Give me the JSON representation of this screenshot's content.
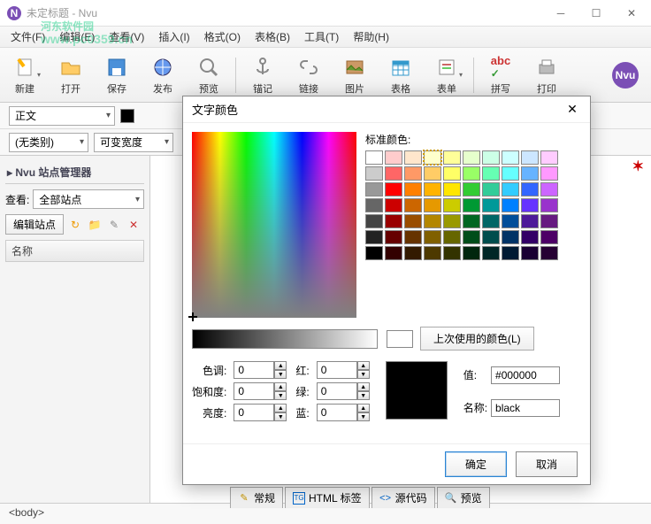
{
  "window": {
    "title": "未定标题 - Nvu",
    "app_icon_text": "N"
  },
  "watermark": {
    "line1": "河东软件园",
    "line2": "www.pc0359.cn"
  },
  "menu": {
    "file": "文件(F)",
    "edit": "编辑(E)",
    "view": "查看(V)",
    "insert": "插入(I)",
    "format": "格式(O)",
    "table": "表格(B)",
    "tools": "工具(T)",
    "help": "帮助(H)"
  },
  "toolbar": {
    "new": "新建",
    "open": "打开",
    "save": "保存",
    "publish": "发布",
    "preview": "预览",
    "anchor": "锚记",
    "link": "链接",
    "image": "图片",
    "table": "表格",
    "form": "表单",
    "spell": "拼写",
    "print": "打印",
    "nvu": "Nvu"
  },
  "formatbar": {
    "paragraph": "正文",
    "category": "(无类别)",
    "width": "可变宽度"
  },
  "sidebar": {
    "title_prefix": "Nvu",
    "title": "站点管理器",
    "view_label": "查看:",
    "view_value": "全部站点",
    "edit_btn": "编辑站点",
    "column": "名称"
  },
  "tabs": {
    "normal": "常规",
    "html": "HTML 标签",
    "source": "源代码",
    "preview": "预览"
  },
  "status": {
    "path": "<body>"
  },
  "dialog": {
    "title": "文字颜色",
    "standard_label": "标准颜色:",
    "last_used": "上次使用的颜色(L)",
    "hue": "色调:",
    "sat": "饱和度:",
    "light": "亮度:",
    "red": "红:",
    "green": "绿:",
    "blue": "蓝:",
    "value_label": "值:",
    "name_label": "名称:",
    "hue_v": "0",
    "sat_v": "0",
    "light_v": "0",
    "red_v": "0",
    "green_v": "0",
    "blue_v": "0",
    "hex": "#000000",
    "name": "black",
    "ok": "确定",
    "cancel": "取消",
    "swatches": [
      "#ffffff",
      "#ffcccc",
      "#ffe6cc",
      "#ffffcc",
      "#ffff99",
      "#e6ffcc",
      "#ccffe6",
      "#ccffff",
      "#cce6ff",
      "#ffccff",
      "#cccccc",
      "#ff6666",
      "#ff9966",
      "#ffcc66",
      "#ffff66",
      "#99ff66",
      "#66ffb3",
      "#66ffff",
      "#66b3ff",
      "#ff99ff",
      "#999999",
      "#ff0000",
      "#ff8000",
      "#ffb300",
      "#ffe600",
      "#33cc33",
      "#33cc99",
      "#33ccff",
      "#3366ff",
      "#cc66ff",
      "#666666",
      "#cc0000",
      "#cc6600",
      "#e69900",
      "#cccc00",
      "#009933",
      "#009999",
      "#0080ff",
      "#6633ff",
      "#9933cc",
      "#444444",
      "#990000",
      "#994d00",
      "#b38600",
      "#999900",
      "#006622",
      "#006666",
      "#004d99",
      "#4d1a99",
      "#661a80",
      "#222222",
      "#660000",
      "#663300",
      "#806000",
      "#666600",
      "#004d1a",
      "#004d4d",
      "#003366",
      "#330066",
      "#4d0066",
      "#000000",
      "#330000",
      "#331a00",
      "#4d3900",
      "#333300",
      "#00260d",
      "#002626",
      "#001a33",
      "#1a0033",
      "#260033"
    ],
    "selected_swatch_index": 3
  }
}
